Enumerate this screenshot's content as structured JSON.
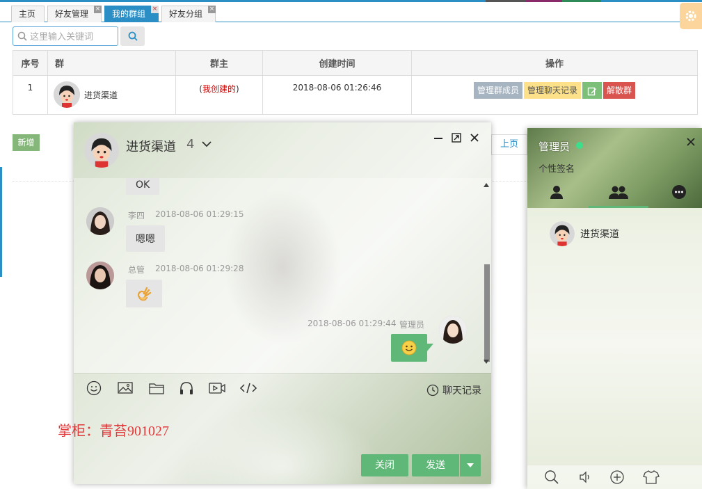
{
  "tabs": [
    {
      "label": "主页",
      "closable": false,
      "active": false
    },
    {
      "label": "好友管理",
      "closable": true,
      "active": false
    },
    {
      "label": "我的群组",
      "closable": true,
      "active": true
    },
    {
      "label": "好友分组",
      "closable": true,
      "active": false
    }
  ],
  "close_glyph": "×",
  "search": {
    "placeholder": "这里输入关键词"
  },
  "table": {
    "headers": [
      "序号",
      "群",
      "群主",
      "创建时间",
      "操作"
    ],
    "rows": [
      {
        "index": "1",
        "group": "进货渠道",
        "owner": "(我创建的)",
        "owner_paren_open": "(",
        "owner_text": "我创建的",
        "owner_paren_close": ")",
        "created": "2018-08-06 01:26:46",
        "actions": {
          "members": "管理群成员",
          "history": "管理聊天记录",
          "edit_icon": "edit-icon",
          "dissolve": "解散群"
        }
      }
    ]
  },
  "new_button": "新增",
  "prev_page": "上页",
  "watermark": "掌柜：青苔901027",
  "chat": {
    "title": "进货渠道",
    "count": "4",
    "messages": [
      {
        "text": "OK",
        "self": false
      },
      {
        "sender": "李四",
        "time": "2018-08-06 01:29:15",
        "text": "嗯嗯",
        "self": false
      },
      {
        "sender": "总管",
        "time": "2018-08-06 01:29:28",
        "emoji": "ok-hand",
        "self": false
      },
      {
        "sender": "管理员",
        "time": "2018-08-06 01:29:44",
        "emoji": "smile",
        "self": true
      }
    ],
    "toolbar": [
      "smile-icon",
      "image-icon",
      "folder-icon",
      "headphones-icon",
      "video-icon",
      "code-icon"
    ],
    "history_label": "聊天记录",
    "close_label": "关闭",
    "send_label": "发送"
  },
  "panel": {
    "username": "管理员",
    "signature": "个性签名",
    "groups": [
      {
        "name": "进货渠道"
      }
    ],
    "status_color": "#3cdf8c"
  },
  "colors": {
    "primary": "#2b8fc6",
    "green": "#5fb878",
    "new_btn": "#86b77a",
    "action_gray": "#a6b3c0",
    "action_yellow": "#fce18a",
    "action_green": "#7cbf79",
    "action_red": "#d9534f",
    "owner_red": "#cc0000"
  }
}
